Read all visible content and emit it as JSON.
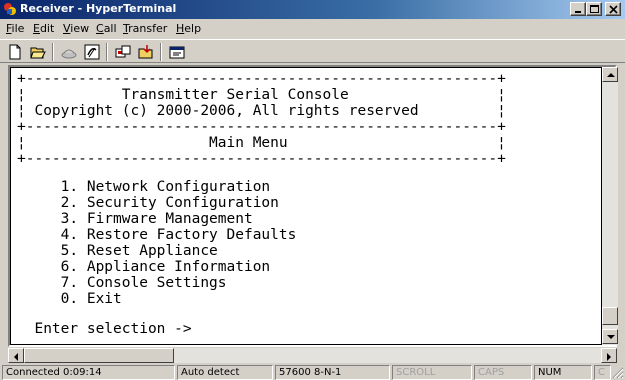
{
  "window": {
    "title": "Receiver - HyperTerminal",
    "controls": [
      "minimize",
      "maximize",
      "close"
    ]
  },
  "menu": {
    "items": [
      {
        "label": "File",
        "mnemonic": "F"
      },
      {
        "label": "Edit",
        "mnemonic": "E"
      },
      {
        "label": "View",
        "mnemonic": "V"
      },
      {
        "label": "Call",
        "mnemonic": "C"
      },
      {
        "label": "Transfer",
        "mnemonic": "T"
      },
      {
        "label": "Help",
        "mnemonic": "H"
      }
    ]
  },
  "toolbar": {
    "buttons": [
      "new-connection-icon",
      "open-icon",
      "disconnect-icon",
      "dial-icon",
      "send-icon",
      "receive-icon",
      "properties-icon"
    ]
  },
  "terminal": {
    "lines": [
      "+------------------------------------------------------+",
      "¦           Transmitter Serial Console                 ¦",
      "¦ Copyright (c) 2000-2006, All rights reserved         ¦",
      "+------------------------------------------------------+",
      "¦                     Main Menu                        ¦",
      "+------------------------------------------------------+",
      "",
      "",
      "     1. Network Configuration",
      "     2. Security Configuration",
      "     3. Firmware Management",
      "     4. Restore Factory Defaults",
      "     5. Reset Appliance",
      "     6. Appliance Information",
      "     7. Console Settings",
      "     0. Exit",
      "",
      "  Enter selection ->"
    ]
  },
  "status": {
    "connected": "Connected 0:09:14",
    "detect": "Auto detect",
    "port_settings": "57600 8-N-1",
    "scroll": "SCROLL",
    "caps": "CAPS",
    "num": "NUM",
    "capture": "C"
  }
}
